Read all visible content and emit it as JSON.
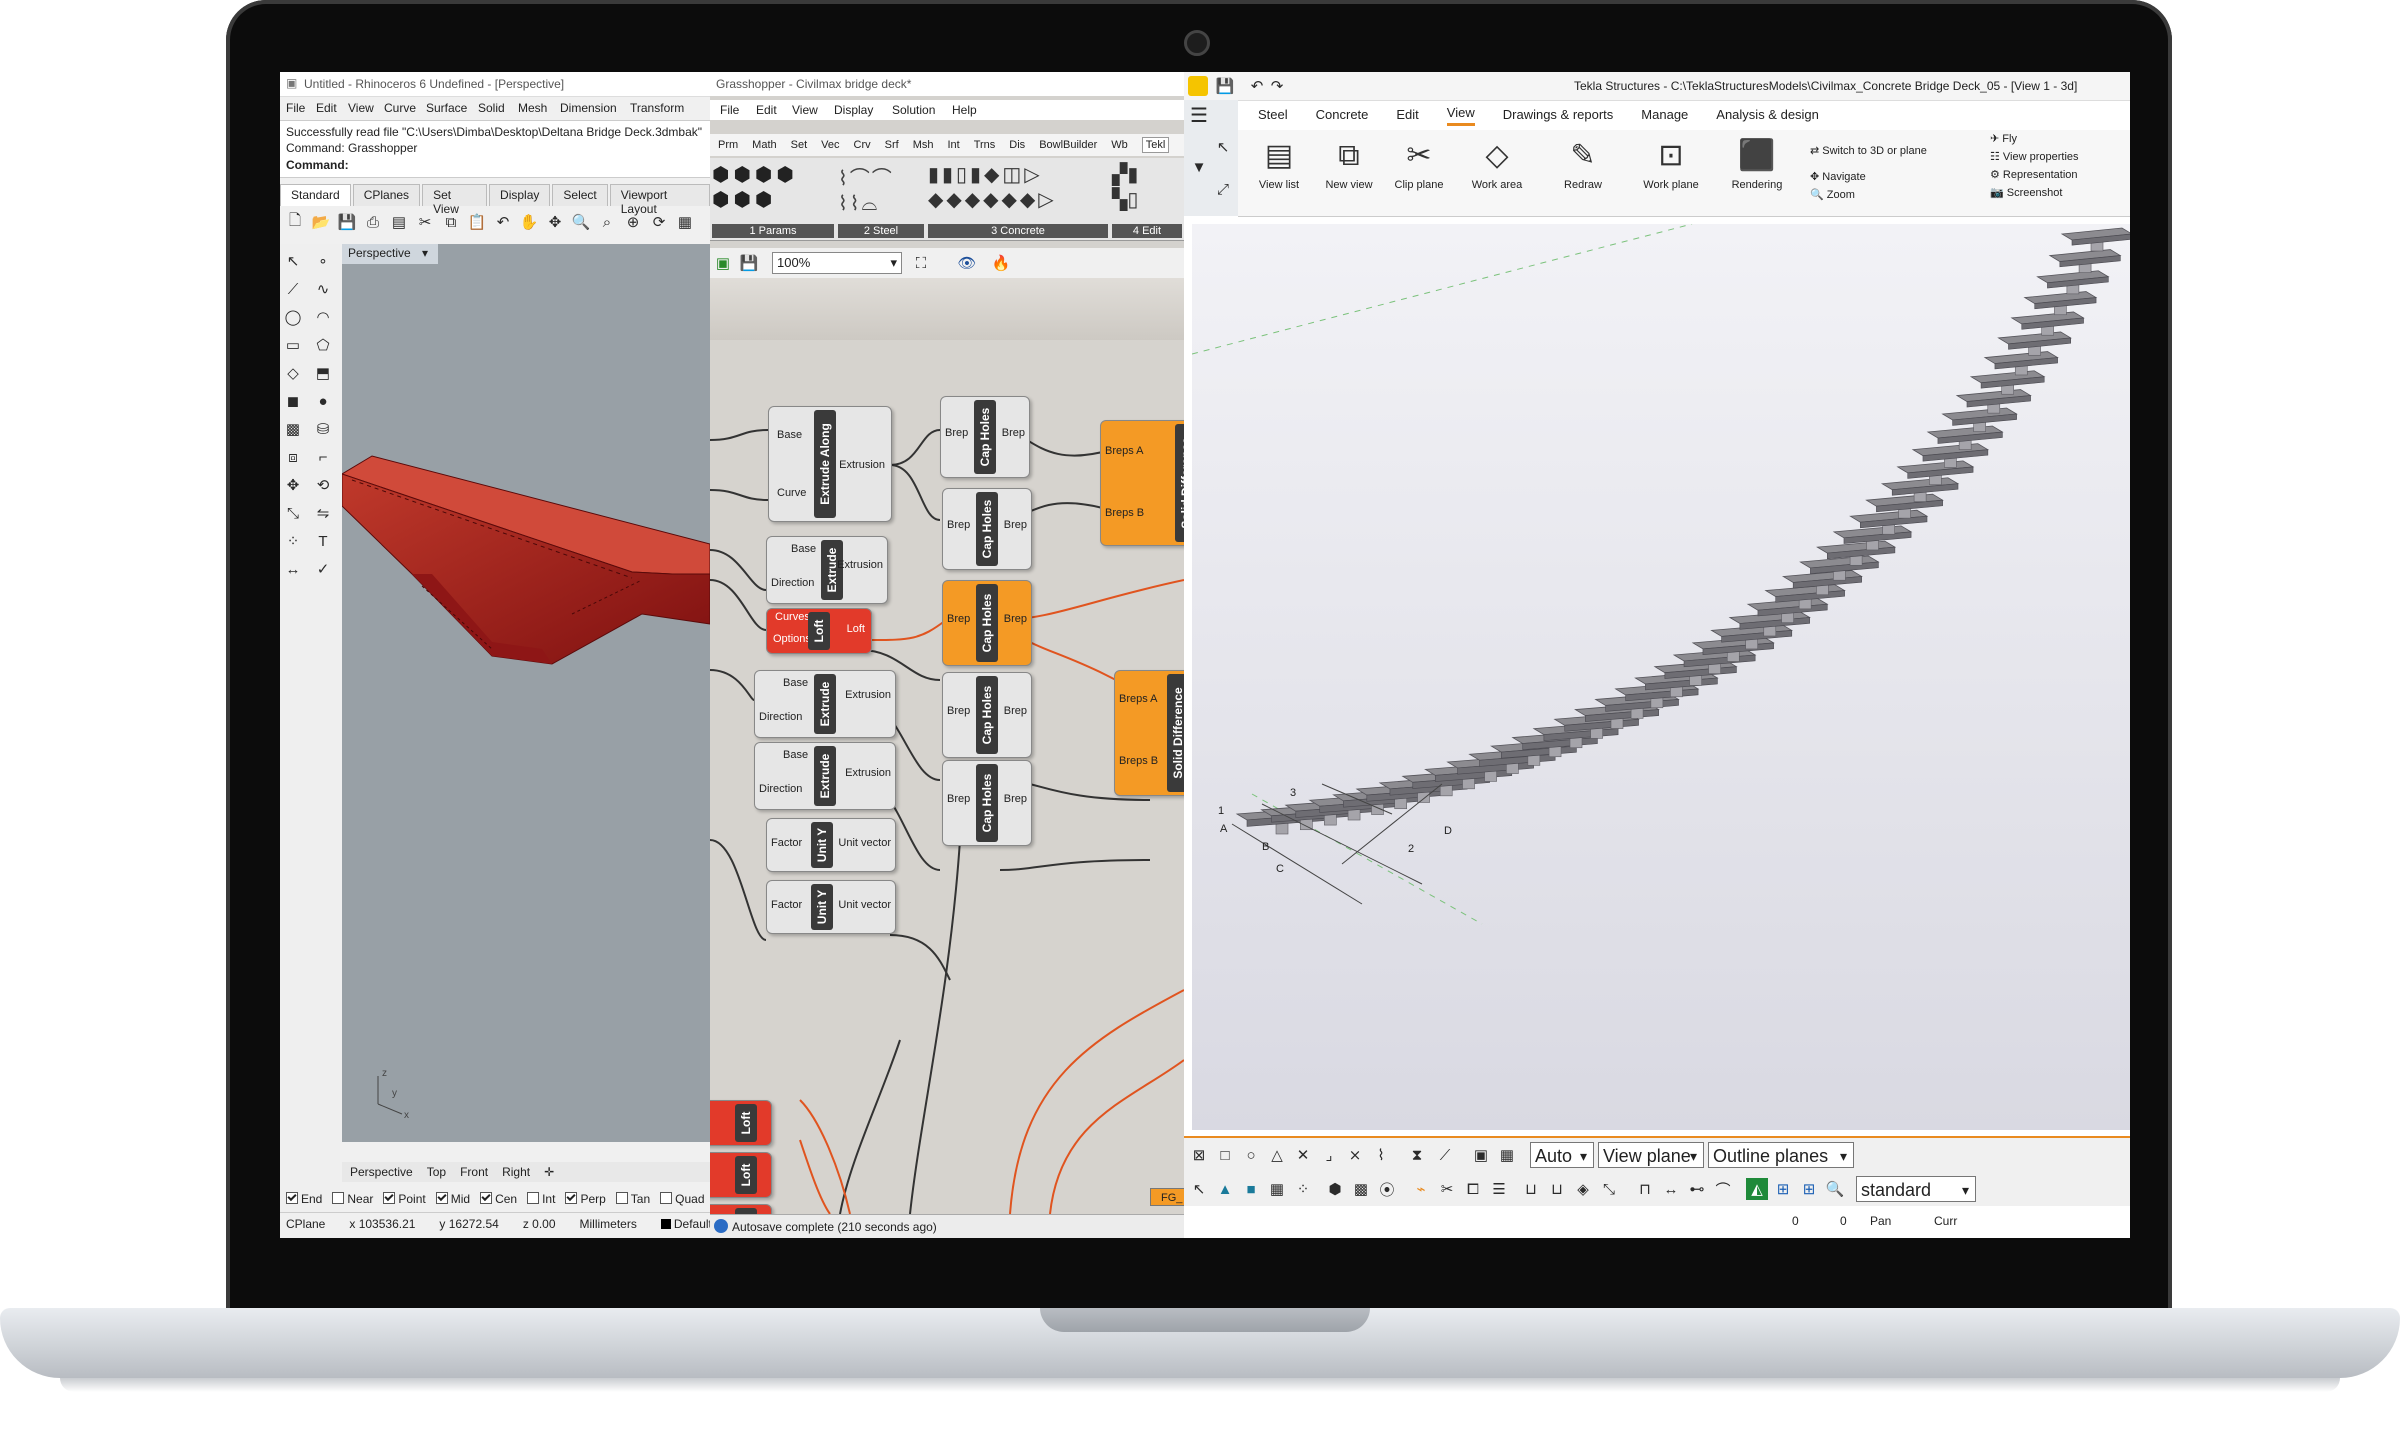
{
  "rhino": {
    "title": "Untitled - Rhinoceros 6 Undefined - [Perspective]",
    "menu": [
      "File",
      "Edit",
      "View",
      "Curve",
      "Surface",
      "Solid",
      "Mesh",
      "Dimension",
      "Transform"
    ],
    "cmd_line1": "Successfully read file \"C:\\Users\\Dimba\\Desktop\\Deltana Bridge Deck.3dmbak\"",
    "cmd_line2": "Command: Grasshopper",
    "cmd_prompt": "Command:",
    "tabs": [
      "Standard",
      "CPlanes",
      "Set View",
      "Display",
      "Select",
      "Viewport Layout"
    ],
    "viewport_label": "Perspective",
    "viewport_tabs": [
      "Perspective",
      "Top",
      "Front",
      "Right"
    ],
    "osnaps": [
      {
        "label": "End",
        "on": true
      },
      {
        "label": "Near",
        "on": false
      },
      {
        "label": "Point",
        "on": true
      },
      {
        "label": "Mid",
        "on": true
      },
      {
        "label": "Cen",
        "on": true
      },
      {
        "label": "Int",
        "on": false
      },
      {
        "label": "Perp",
        "on": true
      },
      {
        "label": "Tan",
        "on": false
      },
      {
        "label": "Quad",
        "on": false
      }
    ],
    "status": {
      "cplane": "CPlane",
      "x": "x 103536.21",
      "y": "y 16272.54",
      "z": "z 0.00",
      "units": "Millimeters",
      "layer": "Default"
    }
  },
  "grasshopper": {
    "title": "Grasshopper - Civilmax bridge deck*",
    "menu": [
      "File",
      "Edit",
      "View",
      "Display",
      "Solution",
      "Help"
    ],
    "categories": [
      "Prm",
      "Math",
      "Set",
      "Vec",
      "Crv",
      "Srf",
      "Msh",
      "Int",
      "Trns",
      "Dis",
      "BowlBuilder",
      "Wb"
    ],
    "active_category": "Tekl",
    "ribbon_groups": [
      "1 Params",
      "2 Steel",
      "3 Concrete",
      "4 Edit"
    ],
    "zoom": "100%",
    "status": "Autosave complete (210 seconds ago)",
    "nodes": {
      "extrude_along": {
        "name": "Extrude Along",
        "in": [
          "Base",
          "Curve"
        ],
        "out": [
          "Extrusion"
        ]
      },
      "extrude": {
        "name": "Extrude",
        "in": [
          "Base",
          "Direction"
        ],
        "out": [
          "Extrusion"
        ]
      },
      "loft": {
        "name": "Loft",
        "in": [
          "Curves",
          "Options"
        ],
        "out": [
          "Loft"
        ]
      },
      "cap_holes": {
        "name": "Cap Holes",
        "in": [
          "Brep"
        ],
        "out": [
          "Brep"
        ]
      },
      "solid_difference": {
        "name": "Solid Difference",
        "in": [
          "Breps A",
          "Breps B"
        ]
      },
      "unit_y": {
        "name": "Unit Y",
        "in": [
          "Factor"
        ],
        "out": [
          "Unit vector"
        ]
      },
      "fg_tag": "FG_"
    }
  },
  "tekla": {
    "title": "Tekla Structures - C:\\TeklaStructuresModels\\Civilmax_Concrete Bridge Deck_05 - [View 1 - 3d]",
    "tabs": [
      "Steel",
      "Concrete",
      "Edit",
      "View",
      "Drawings & reports",
      "Manage",
      "Analysis & design"
    ],
    "active_tab": "View",
    "ribbon": [
      "View list",
      "New view",
      "Clip plane",
      "Work area",
      "Redraw",
      "Work plane",
      "Rendering"
    ],
    "ribbon_small": [
      "Switch to 3D or plane",
      "Navigate",
      "Zoom",
      "Fly",
      "View properties",
      "Representation",
      "Screenshot"
    ],
    "selects": {
      "snap_mode": "Auto",
      "plane": "View plane",
      "outline": "Outline planes",
      "standard": "standard"
    },
    "status": {
      "a": "0",
      "b": "0",
      "pan": "Pan",
      "curr": "Curr"
    },
    "grid_labels": [
      "A",
      "B",
      "C",
      "D",
      "1",
      "2",
      "3"
    ]
  },
  "colors": {
    "rhino_deck": "#b22222",
    "gh_orange": "#f49a25",
    "gh_red": "#e23a2a",
    "tekla_accent": "#e98a1f"
  }
}
